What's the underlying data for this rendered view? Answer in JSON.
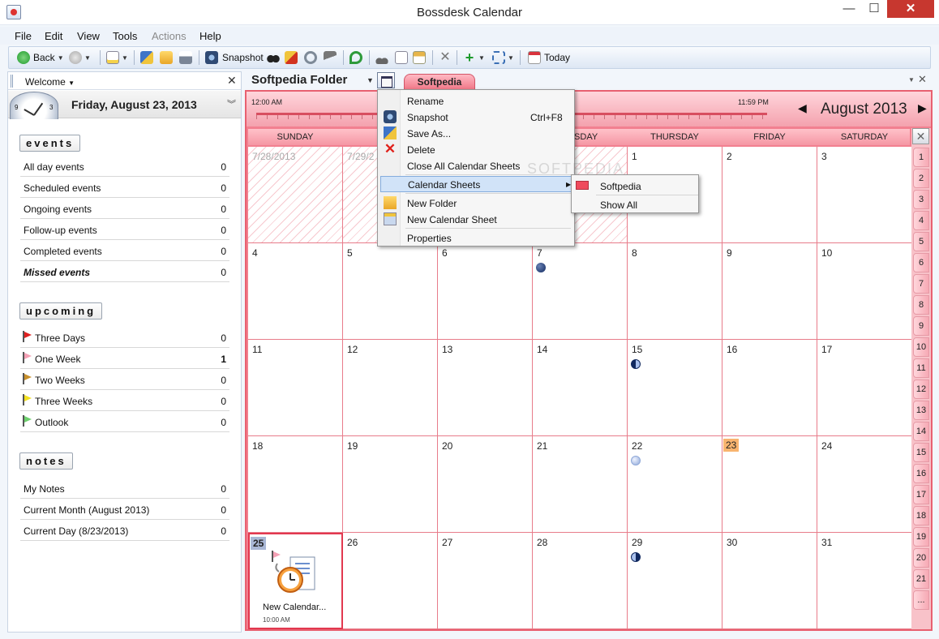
{
  "window": {
    "title": "Bossdesk Calendar",
    "min": "—",
    "max": "☐",
    "close": "✕"
  },
  "menu": [
    "File",
    "Edit",
    "View",
    "Tools",
    "Actions",
    "Help"
  ],
  "toolbar": {
    "back": "Back",
    "snapshot": "Snapshot",
    "today": "Today"
  },
  "left": {
    "welcome": "Welcome",
    "date": "Friday, August 23, 2013",
    "clock_nums": [
      "9",
      "3"
    ],
    "events": {
      "title": "events",
      "rows": [
        {
          "label": "All day events",
          "count": "0"
        },
        {
          "label": "Scheduled events",
          "count": "0"
        },
        {
          "label": "Ongoing events",
          "count": "0"
        },
        {
          "label": "Follow-up events",
          "count": "0"
        },
        {
          "label": "Completed events",
          "count": "0"
        },
        {
          "label": "Missed events",
          "count": "0"
        }
      ]
    },
    "upcoming": {
      "title": "upcoming",
      "rows": [
        {
          "label": "Three Days",
          "count": "0",
          "color": "#e02020"
        },
        {
          "label": "One Week",
          "count": "1",
          "color": "#f4a0b4"
        },
        {
          "label": "Two Weeks",
          "count": "0",
          "color": "#c8902c"
        },
        {
          "label": "Three Weeks",
          "count": "0",
          "color": "#f2e021"
        },
        {
          "label": "Outlook",
          "count": "0",
          "color": "#6ccf6c"
        }
      ]
    },
    "notes": {
      "title": "notes",
      "rows": [
        {
          "label": "My Notes",
          "count": "0"
        },
        {
          "label": "Current Month (August 2013)",
          "count": "0"
        },
        {
          "label": "Current Day (8/23/2013)",
          "count": "0"
        }
      ]
    }
  },
  "pane": {
    "folder": "Softpedia Folder",
    "tab": "Softpedia",
    "close": "✕"
  },
  "calendar": {
    "time_start": "12:00 AM",
    "time_end": "11:59 PM",
    "month": "August 2013",
    "prev": "◀",
    "next": "▶",
    "weekdays": [
      "SUNDAY",
      "M",
      "",
      "NESDAY",
      "THURSDAY",
      "FRIDAY",
      "SATURDAY"
    ],
    "weeks": [
      [
        "7/28/2013",
        "7/29/2",
        "",
        "3",
        "1",
        "2",
        "3"
      ],
      [
        "4",
        "5",
        "6",
        "7",
        "8",
        "9",
        "10"
      ],
      [
        "11",
        "12",
        "13",
        "14",
        "15",
        "16",
        "17"
      ],
      [
        "18",
        "19",
        "20",
        "21",
        "22",
        "23",
        "24"
      ],
      [
        "25",
        "26",
        "27",
        "28",
        "29",
        "30",
        "31"
      ]
    ],
    "week_numbers": [
      "1",
      "2",
      "3",
      "4",
      "5",
      "6",
      "7",
      "8",
      "9",
      "10",
      "11",
      "12",
      "13",
      "14",
      "15",
      "16",
      "17",
      "18",
      "19",
      "20",
      "21",
      "..."
    ],
    "event": {
      "title": "New Calendar...",
      "time": "10:00 AM"
    },
    "watermark": "SOFTPEDIA"
  },
  "context_menu": {
    "items": [
      {
        "label": "Rename",
        "shortcut": ""
      },
      {
        "label": "Snapshot",
        "shortcut": "Ctrl+F8"
      },
      {
        "label": "Save As...",
        "shortcut": ""
      },
      {
        "label": "Delete",
        "shortcut": ""
      },
      {
        "label": "Close All Calendar Sheets",
        "shortcut": ""
      },
      {
        "label": "Calendar Sheets",
        "shortcut": ""
      },
      {
        "label": "New Folder",
        "shortcut": ""
      },
      {
        "label": "New Calendar Sheet",
        "shortcut": ""
      },
      {
        "label": "Properties",
        "shortcut": ""
      }
    ],
    "submenu": [
      "Softpedia",
      "Show All"
    ]
  }
}
